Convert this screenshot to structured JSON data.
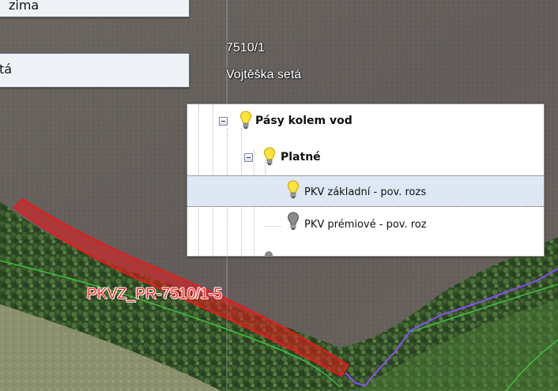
{
  "map": {
    "parcel_id": "7510/1",
    "parcel_crop": "Vojtěška setá",
    "feature_label": "PKVZ_PR-7510/1-5",
    "colors": {
      "feature_stroke": "#e81a1a",
      "purple_boundary": "#8a4cff",
      "green_boundary": "#3fbf3f"
    }
  },
  "top_boxes": {
    "box1_text": "zima",
    "box2_text": "tá"
  },
  "layer_tree": {
    "rows": [
      {
        "label": "Pásy kolem vod",
        "level": 0,
        "bold": true,
        "icon": "bulb-on-icon",
        "expander": "collapse-icon"
      },
      {
        "label": "Platné",
        "level": 1,
        "bold": true,
        "icon": "bulb-on-icon",
        "expander": "collapse-icon"
      },
      {
        "label": "PKV základní - pov. rozs",
        "level": 2,
        "bold": false,
        "icon": "bulb-on-icon",
        "selected": true
      },
      {
        "label": "PKV prémiové - pov. roz",
        "level": 2,
        "bold": false,
        "icon": "bulb-off-icon"
      }
    ]
  }
}
